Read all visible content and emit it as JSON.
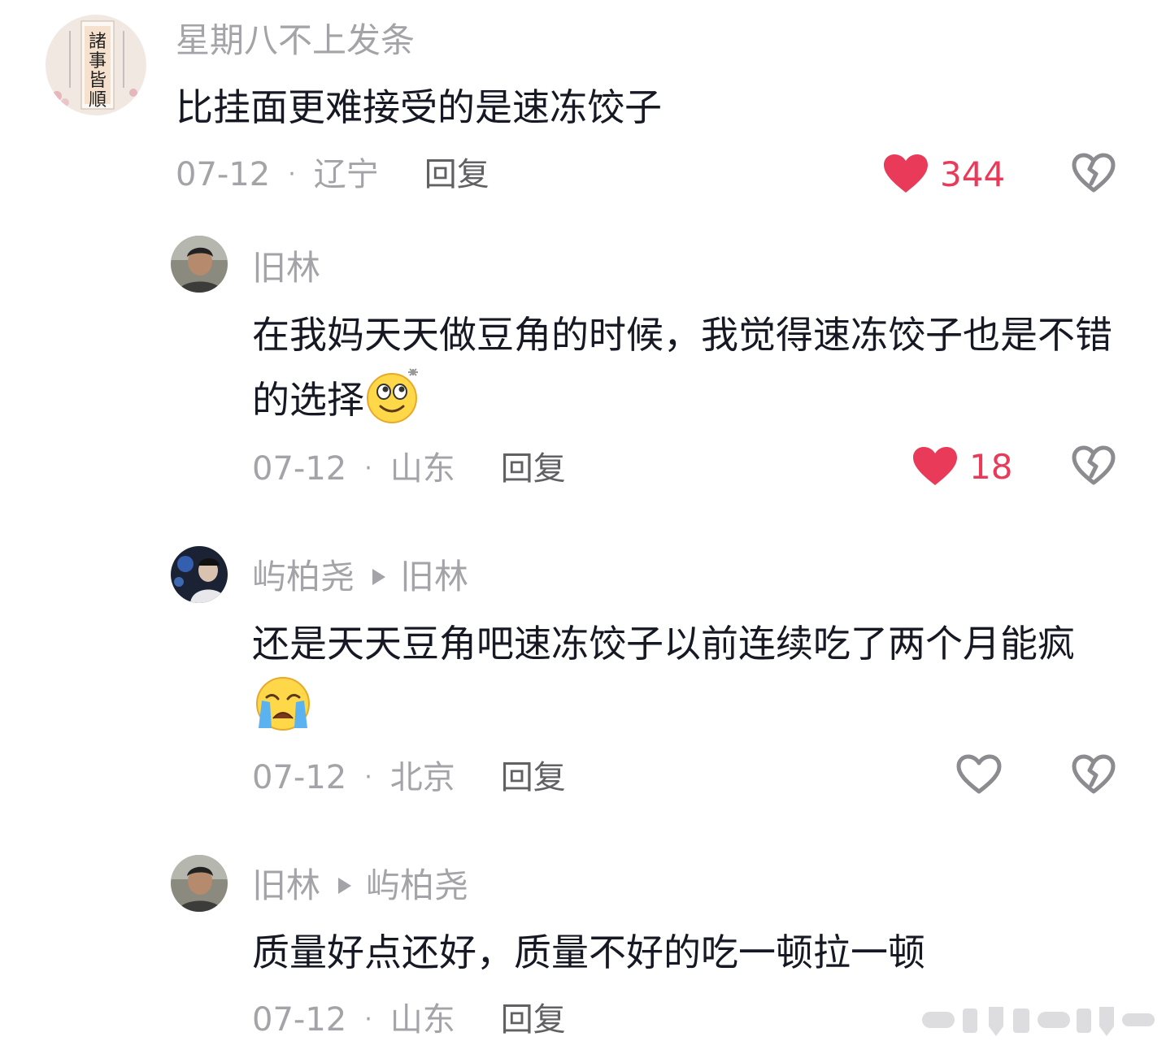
{
  "comments": [
    {
      "username": "星期八不上发条",
      "reply_to": "",
      "text": "比挂面更难接受的是速冻饺子",
      "date": "07-12",
      "location": "辽宁",
      "reply_label": "回复",
      "likes": "344",
      "liked": true
    },
    {
      "username": "旧林",
      "reply_to": "",
      "text": "在我妈天天做豆角的时候，我觉得速冻饺子也是不错的选择",
      "emoji": "rolling-eyes-smile-emoji",
      "date": "07-12",
      "location": "山东",
      "reply_label": "回复",
      "likes": "18",
      "liked": true
    },
    {
      "username": "屿柏尧",
      "reply_to": "旧林",
      "text": "还是天天豆角吧速冻饺子以前连续吃了两个月能疯",
      "emoji": "crying-face-emoji",
      "date": "07-12",
      "location": "北京",
      "reply_label": "回复",
      "likes": "",
      "liked": false
    },
    {
      "username": "旧林",
      "reply_to": "屿柏尧",
      "text": "质量好点还好，质量不好的吃一顿拉一顿",
      "date": "07-12",
      "location": "山东",
      "reply_label": "回复"
    }
  ],
  "colors": {
    "like_red": "#ea3a5a",
    "gray_text": "#a3a3a8",
    "main_text": "#161823"
  }
}
